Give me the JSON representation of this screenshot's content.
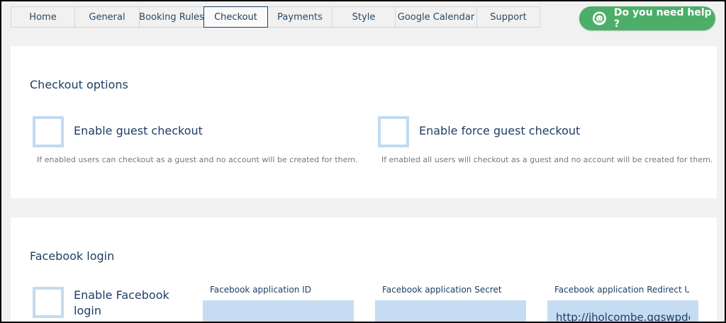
{
  "tabs": [
    {
      "label": "Home"
    },
    {
      "label": "General"
    },
    {
      "label": "Booking Rules"
    },
    {
      "label": "Checkout",
      "active": true
    },
    {
      "label": "Payments"
    },
    {
      "label": "Style"
    },
    {
      "label": "Google Calendar"
    },
    {
      "label": "Support"
    }
  ],
  "help": {
    "label": "Do you need help ?"
  },
  "checkout": {
    "title": "Checkout options",
    "guest": {
      "label": "Enable guest checkout",
      "description": "If enabled users can checkout as a guest and no account will be created for them."
    },
    "force_guest": {
      "label": "Enable force guest checkout",
      "description": "If enabled all users will checkout as a guest and no account will be created for them."
    }
  },
  "facebook": {
    "title": "Facebook login",
    "enable": {
      "label_line1": "Enable Facebook",
      "label_line2": "login"
    },
    "app_id": {
      "label": "Facebook application ID",
      "value": ""
    },
    "app_secret": {
      "label": "Facebook application Secret",
      "value": ""
    },
    "redirect_uri": {
      "label": "Facebook application Redirect URI",
      "value": "http://jholcombe.ggswpdev.com"
    }
  },
  "colors": {
    "accent": "#1e3e64",
    "help_green": "#4cae68",
    "input_bg": "#c6dcf2",
    "checkbox_border": "#c3daf0"
  }
}
